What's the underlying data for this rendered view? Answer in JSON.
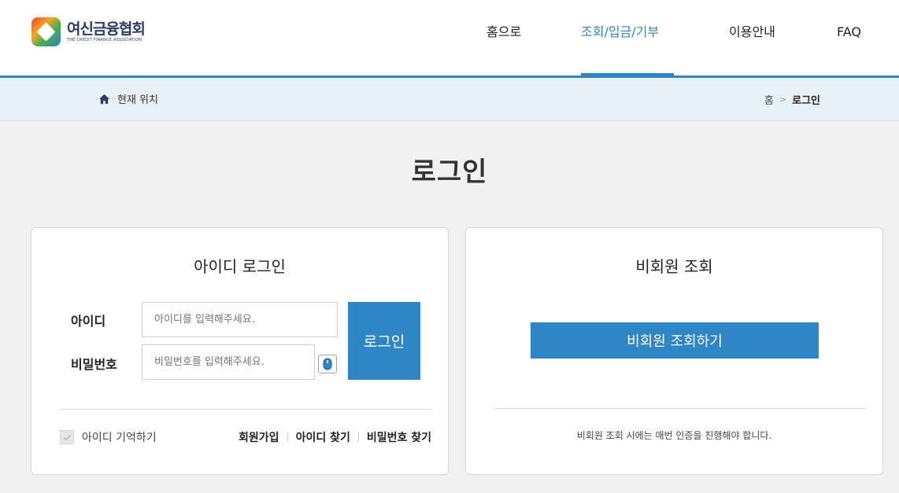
{
  "logo": {
    "title": "여신금융협회",
    "subtitle": "THE CREDIT FINANCE ASSOCIATION"
  },
  "nav": {
    "items": [
      {
        "label": "홈으로",
        "active": false
      },
      {
        "label": "조회/입금/기부",
        "active": true
      },
      {
        "label": "이용안내",
        "active": false
      },
      {
        "label": "FAQ",
        "active": false
      }
    ]
  },
  "location": {
    "label": "현재 위치",
    "home": "홈",
    "current": "로그인"
  },
  "page": {
    "title": "로그인"
  },
  "login": {
    "title": "아이디 로그인",
    "id_label": "아이디",
    "id_placeholder": "아이디를 입력해주세요.",
    "pw_label": "비밀번호",
    "pw_placeholder": "비밀번호를 입력해주세요.",
    "submit": "로그인",
    "remember": "아이디 기억하기",
    "links": [
      "회원가입",
      "아이디 찾기",
      "비밀번호 찾기"
    ]
  },
  "guest": {
    "title": "비회원 조회",
    "button": "비회원 조회하기",
    "note": "비회원 조회 시에는 매번 인증을 진행해야 합니다."
  },
  "colors": {
    "accent": "#2f86c6",
    "locbar_bg": "#e8f0f8",
    "page_bg": "#f1f1f1"
  }
}
